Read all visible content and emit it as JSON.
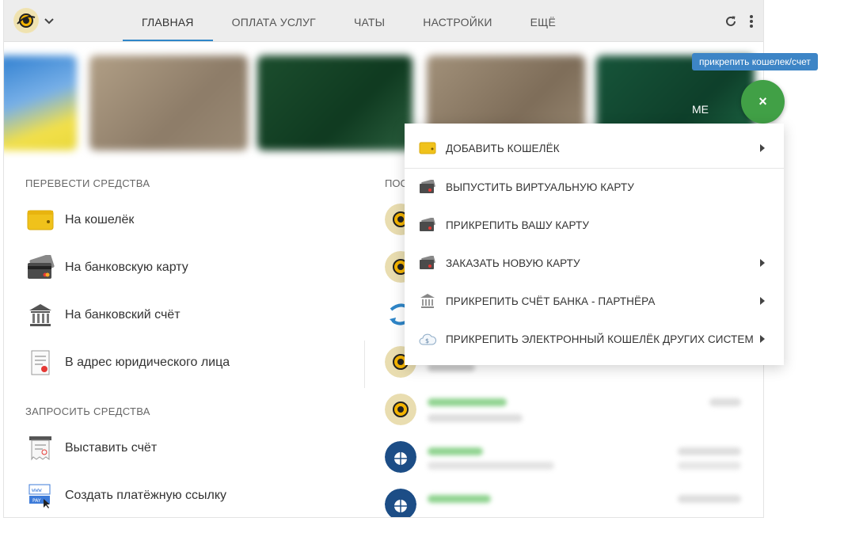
{
  "nav": {
    "tabs": [
      {
        "label": "ГЛАВНАЯ"
      },
      {
        "label": "ОПЛАТА УСЛУГ"
      },
      {
        "label": "ЧАТЫ"
      },
      {
        "label": "НАСТРОЙКИ"
      },
      {
        "label": "ЕЩЁ"
      }
    ],
    "icons": [
      "refresh-icon",
      "more-vert-icon"
    ]
  },
  "cards": {
    "partial_label": "ME"
  },
  "transfer": {
    "title": "ПЕРЕВЕСТИ СРЕДСТВА",
    "items": [
      {
        "label": "На кошелёк",
        "icon": "wallet-icon"
      },
      {
        "label": "На банковскую карту",
        "icon": "bank-card-icon"
      },
      {
        "label": "На банковский счёт",
        "icon": "bank-building-icon"
      },
      {
        "label": "В адрес юридического лица",
        "icon": "document-icon"
      }
    ]
  },
  "request": {
    "title": "ЗАПРОСИТЬ СРЕДСТВА",
    "items": [
      {
        "label": "Выставить счёт",
        "icon": "invoice-icon"
      },
      {
        "label": "Создать платёжную ссылку",
        "icon": "payment-link-icon"
      }
    ]
  },
  "history": {
    "title": "ПОС"
  },
  "fab": {
    "tooltip": "прикрепить кошелек/счет",
    "icon": "close-icon",
    "symbol": "×",
    "color": "#41a046"
  },
  "menu": {
    "items": [
      {
        "label": "ДОБАВИТЬ КОШЕЛЁК",
        "icon": "wallet-icon",
        "submenu": true
      },
      {
        "label": "ВЫПУСТИТЬ ВИРТУАЛЬНУЮ КАРТУ",
        "icon": "card-icon",
        "submenu": false
      },
      {
        "label": "ПРИКРЕПИТЬ ВАШУ КАРТУ",
        "icon": "card-icon",
        "submenu": false
      },
      {
        "label": "ЗАКАЗАТЬ НОВУЮ КАРТУ",
        "icon": "card-icon",
        "submenu": true
      },
      {
        "label": "ПРИКРЕПИТЬ СЧЁТ БАНКА - ПАРТНЁРА",
        "icon": "bank-icon",
        "submenu": true
      },
      {
        "label": "ПРИКРЕПИТЬ ЭЛЕКТРОННЫЙ КОШЕЛЁК ДРУГИХ СИСТЕМ",
        "icon": "cloud-dollar-icon",
        "submenu": true
      }
    ]
  },
  "colors": {
    "accent": "#2f86c8",
    "tooltip": "#3d85c6",
    "wallet": "#f0c21b"
  }
}
